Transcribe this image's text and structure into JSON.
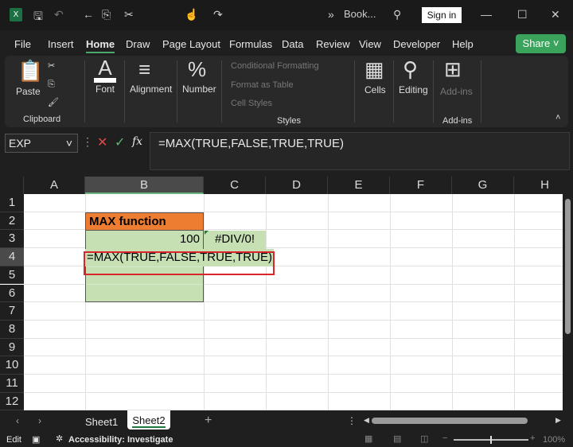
{
  "titlebar": {
    "title": "Book...",
    "sign_in": "Sign in",
    "app_icon": "excel-icon"
  },
  "tabs": [
    {
      "label": "File"
    },
    {
      "label": "Insert"
    },
    {
      "label": "Home",
      "active": true
    },
    {
      "label": "Draw"
    },
    {
      "label": "Page Layout"
    },
    {
      "label": "Formulas"
    },
    {
      "label": "Data"
    },
    {
      "label": "Review"
    },
    {
      "label": "View"
    },
    {
      "label": "Developer"
    },
    {
      "label": "Help"
    }
  ],
  "share": "Share",
  "ribbon": {
    "paste": "Paste",
    "clipboard": "Clipboard",
    "font": "Font",
    "alignment": "Alignment",
    "number": "Number",
    "conditional_formatting": "Conditional Formatting",
    "format_as_table": "Format as Table",
    "cell_styles": "Cell Styles",
    "styles": "Styles",
    "cells": "Cells",
    "editing": "Editing",
    "addins_btn": "Add-ins",
    "addins_group": "Add-ins"
  },
  "formula_bar": {
    "name_box": "EXP",
    "fx": "fx",
    "formula": "=MAX(TRUE,FALSE,TRUE,TRUE)"
  },
  "grid": {
    "columns": [
      "A",
      "B",
      "C",
      "D",
      "E",
      "F",
      "G",
      "H"
    ],
    "rows": [
      "1",
      "2",
      "3",
      "4",
      "5",
      "6",
      "7",
      "8",
      "9",
      "10",
      "11",
      "12"
    ],
    "cells": {
      "B2": "MAX function",
      "B3": "100",
      "C3": "#DIV/0!",
      "B4": "=MAX(TRUE,FALSE,TRUE,TRUE)"
    },
    "colors": {
      "header_fill": "#ed7d31",
      "data_fill": "#c6e0b4",
      "highlight_box": "#d9262c"
    }
  },
  "sheets": [
    {
      "label": "Sheet1"
    },
    {
      "label": "Sheet2",
      "active": true
    }
  ],
  "status": {
    "mode": "Edit",
    "accessibility": "Accessibility: Investigate",
    "zoom": "100%"
  }
}
